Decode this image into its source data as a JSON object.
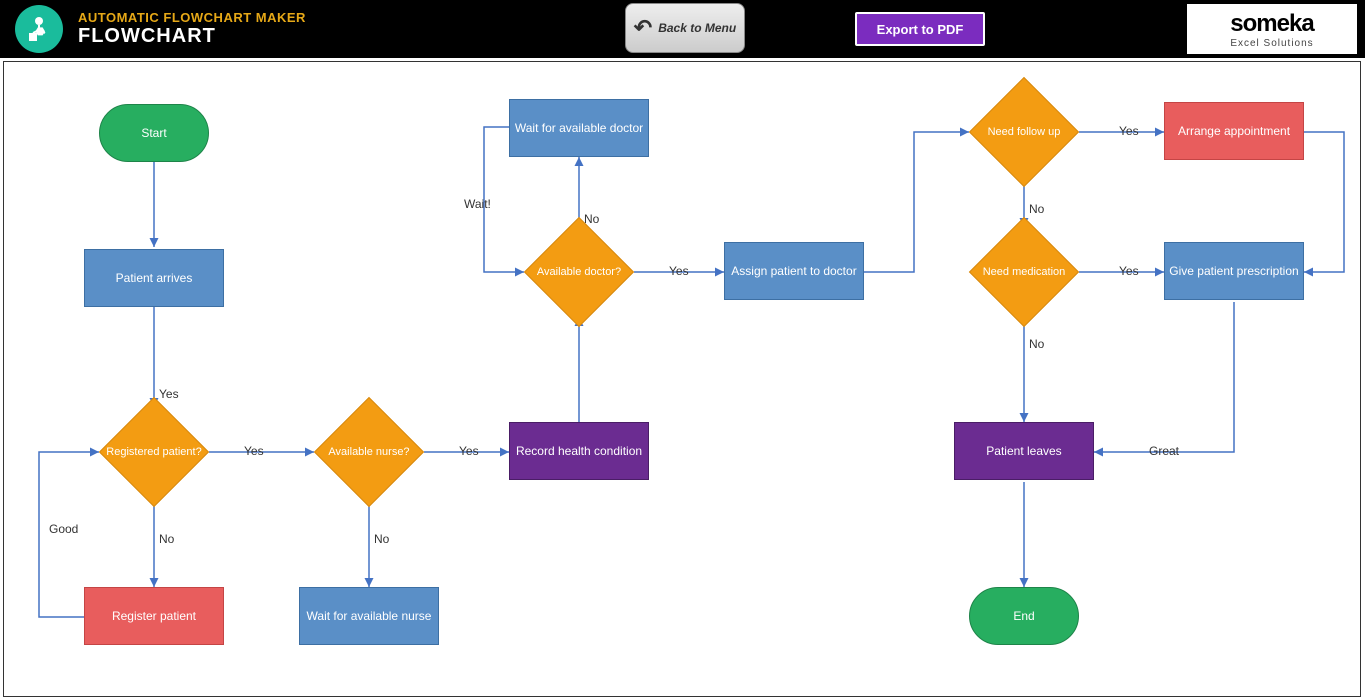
{
  "header": {
    "title1": "AUTOMATIC FLOWCHART MAKER",
    "title2": "FLOWCHART",
    "back_button": "Back to Menu",
    "export_button": "Export to PDF",
    "brand_name": "someka",
    "brand_sub": "Excel Solutions"
  },
  "nodes": {
    "start": "Start",
    "patient_arrives": "Patient arrives",
    "registered_patient": "Registered patient?",
    "register_patient": "Register patient",
    "available_nurse": "Available nurse?",
    "wait_nurse": "Wait for available nurse",
    "record_health": "Record health condition",
    "available_doctor": "Available doctor?",
    "wait_doctor": "Wait for available doctor",
    "assign_patient": "Assign patient to doctor",
    "need_followup": "Need follow up",
    "arrange_appt": "Arrange appointment",
    "need_medication": "Need medication",
    "give_prescription": "Give patient prescription",
    "patient_leaves": "Patient leaves",
    "end": "End"
  },
  "labels": {
    "yes": "Yes",
    "no": "No",
    "good": "Good",
    "wait": "Wait!",
    "great": "Great"
  }
}
